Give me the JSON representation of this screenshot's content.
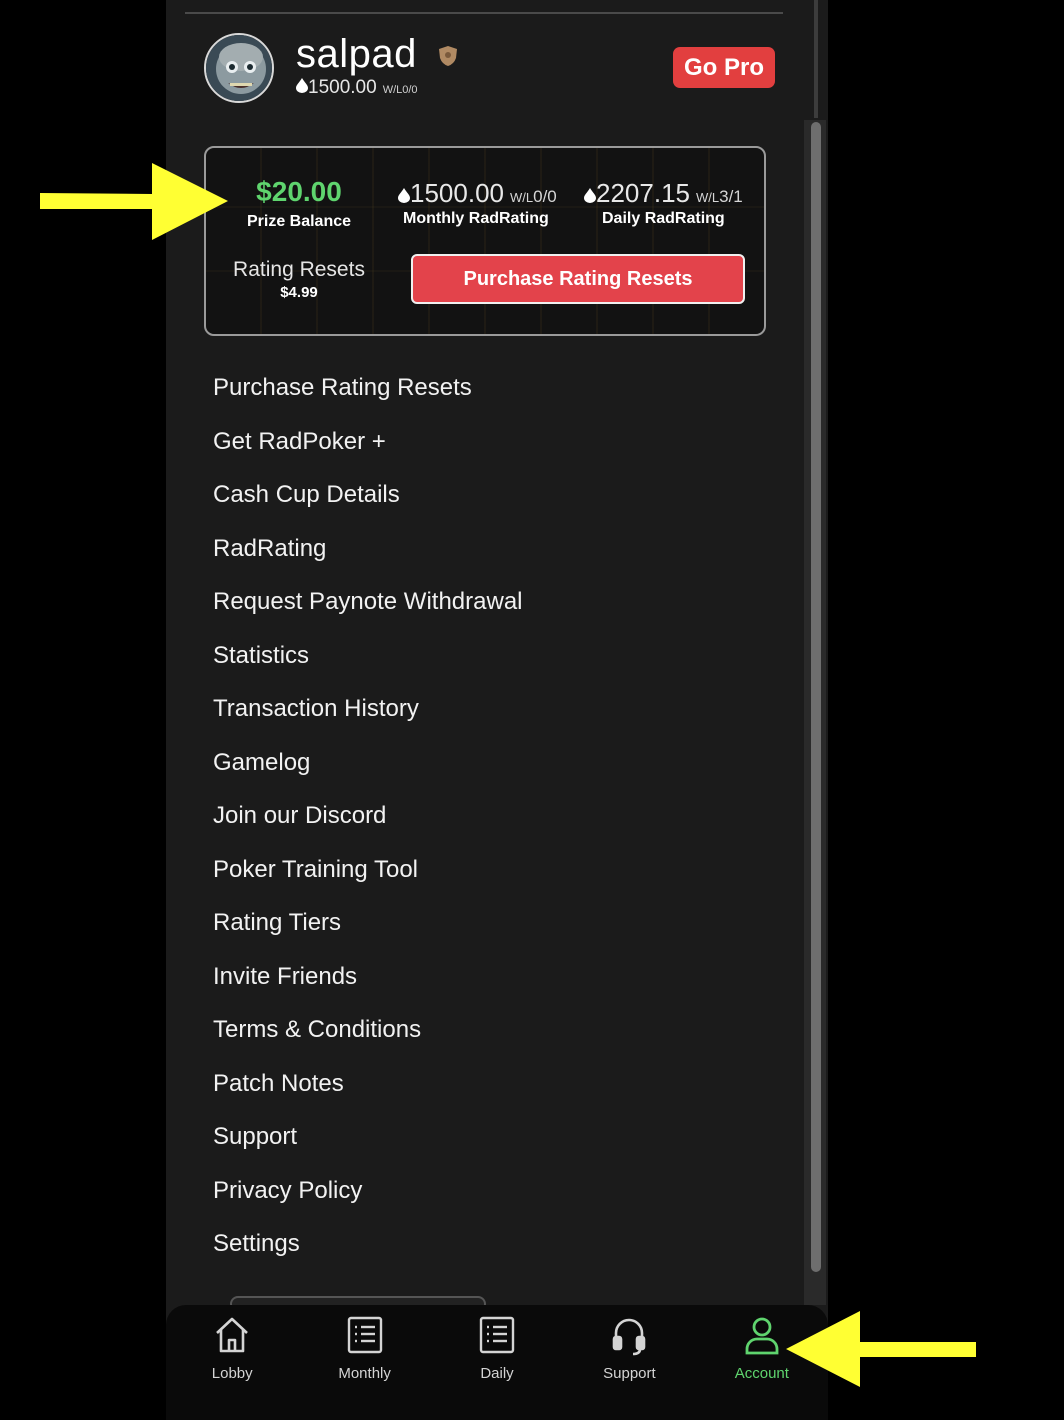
{
  "profile": {
    "username": "salpad",
    "rating": "1500.00",
    "wl": "W/L0/0",
    "go_pro_label": "Go Pro"
  },
  "stats_card": {
    "prize_balance_value": "$20.00",
    "prize_balance_label": "Prize Balance",
    "monthly_rating": "1500.00",
    "monthly_wl_prefix": "W/L",
    "monthly_wl_value": "0/0",
    "monthly_label": "Monthly RadRating",
    "daily_rating": "2207.15",
    "daily_wl_prefix": "W/L",
    "daily_wl_value": "3/1",
    "daily_label": "Daily RadRating",
    "rating_resets_label": "Rating Resets",
    "rating_resets_price": "$4.99",
    "purchase_button_label": "Purchase Rating Resets"
  },
  "menu": [
    "Purchase Rating Resets",
    "Get RadPoker +",
    "Cash Cup Details",
    "RadRating",
    "Request Paynote Withdrawal",
    "Statistics",
    "Transaction History",
    "Gamelog",
    "Join our Discord",
    "Poker Training Tool",
    "Rating Tiers",
    "Invite Friends",
    "Terms & Conditions",
    "Patch Notes",
    "Support",
    "Privacy Policy",
    "Settings"
  ],
  "bottom_nav": {
    "items": [
      {
        "label": "Lobby",
        "icon": "home-icon"
      },
      {
        "label": "Monthly",
        "icon": "list-icon"
      },
      {
        "label": "Daily",
        "icon": "list-icon"
      },
      {
        "label": "Support",
        "icon": "headset-icon"
      },
      {
        "label": "Account",
        "icon": "user-icon",
        "active": true
      }
    ]
  },
  "colors": {
    "accent_green": "#5fd46e",
    "accent_red": "#e3434b",
    "annotation_yellow": "#ffff33"
  }
}
